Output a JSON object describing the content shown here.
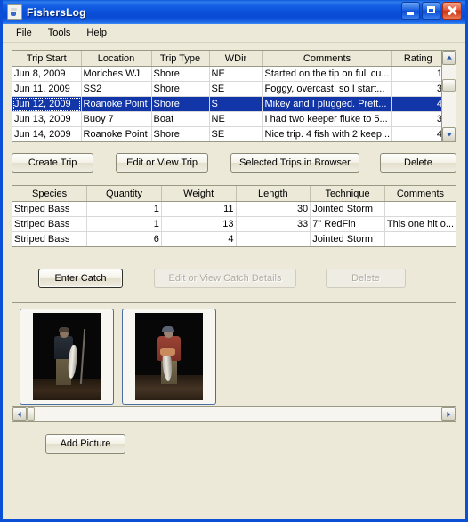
{
  "window": {
    "title": "FishersLog",
    "icon": "java-coffee-cup-icon",
    "minimize_label": "Minimize",
    "maximize_label": "Maximize",
    "close_label": "Close",
    "accent_color": "#0A4FD6",
    "face_color": "#ECE9D8",
    "selection_color": "#1236A8"
  },
  "menu": {
    "items": [
      {
        "label": "File"
      },
      {
        "label": "Tools"
      },
      {
        "label": "Help"
      }
    ]
  },
  "trip_table": {
    "columns": [
      "Trip Start",
      "Location",
      "Trip Type",
      "WDir",
      "Comments",
      "Rating"
    ],
    "rows": [
      {
        "trip_start": "Jun 8, 2009",
        "location": "Moriches WJ",
        "trip_type": "Shore",
        "wdir": "NE",
        "comments": "Started on the tip on full cu...",
        "rating": "1",
        "selected": false
      },
      {
        "trip_start": "Jun 11, 2009",
        "location": "SS2",
        "trip_type": "Shore",
        "wdir": "SE",
        "comments": "Foggy, overcast, so I start...",
        "rating": "3",
        "selected": false
      },
      {
        "trip_start": "Jun 12, 2009",
        "location": "Roanoke Point",
        "trip_type": "Shore",
        "wdir": "S",
        "comments": "Mikey and I plugged. Prett...",
        "rating": "4",
        "selected": true
      },
      {
        "trip_start": "Jun 13, 2009",
        "location": "Buoy 7",
        "trip_type": "Boat",
        "wdir": "NE",
        "comments": "I had two keeper fluke to 5...",
        "rating": "3",
        "selected": false
      },
      {
        "trip_start": "Jun 14, 2009",
        "location": "Roanoke Point",
        "trip_type": "Shore",
        "wdir": "SE",
        "comments": "Nice trip. 4 fish with 2 keep...",
        "rating": "4",
        "selected": false
      }
    ]
  },
  "trip_buttons": [
    {
      "label": "Create Trip",
      "enabled": true
    },
    {
      "label": "Edit or View Trip",
      "enabled": true
    },
    {
      "label": "Selected Trips in Browser",
      "enabled": true
    },
    {
      "label": "Delete",
      "enabled": true
    }
  ],
  "catch_table": {
    "columns": [
      "Species",
      "Quantity",
      "Weight",
      "Length",
      "Technique",
      "Comments"
    ],
    "rows": [
      {
        "species": "Striped Bass",
        "quantity": "1",
        "weight": "11",
        "length": "30",
        "technique": "Jointed Storm",
        "comments": ""
      },
      {
        "species": "Striped Bass",
        "quantity": "1",
        "weight": "13",
        "length": "33",
        "technique": "7\" RedFin",
        "comments": "This one hit o..."
      },
      {
        "species": "Striped Bass",
        "quantity": "6",
        "weight": "4",
        "length": "",
        "technique": "Jointed Storm",
        "comments": ""
      }
    ]
  },
  "catch_buttons": [
    {
      "label": "Enter Catch",
      "enabled": true,
      "focused": true
    },
    {
      "label": "Edit or View Catch Details",
      "enabled": false
    },
    {
      "label": "Delete",
      "enabled": false
    }
  ],
  "photos": {
    "items": [
      {
        "caption": "angler holding striped bass at night with rod"
      },
      {
        "caption": "angler in red jacket holding striped bass at night"
      }
    ]
  },
  "photo_button": {
    "label": "Add Picture"
  },
  "scroll": {
    "trip_up": "scroll-up",
    "trip_down": "scroll-down",
    "photo_left": "scroll-left",
    "photo_right": "scroll-right"
  }
}
